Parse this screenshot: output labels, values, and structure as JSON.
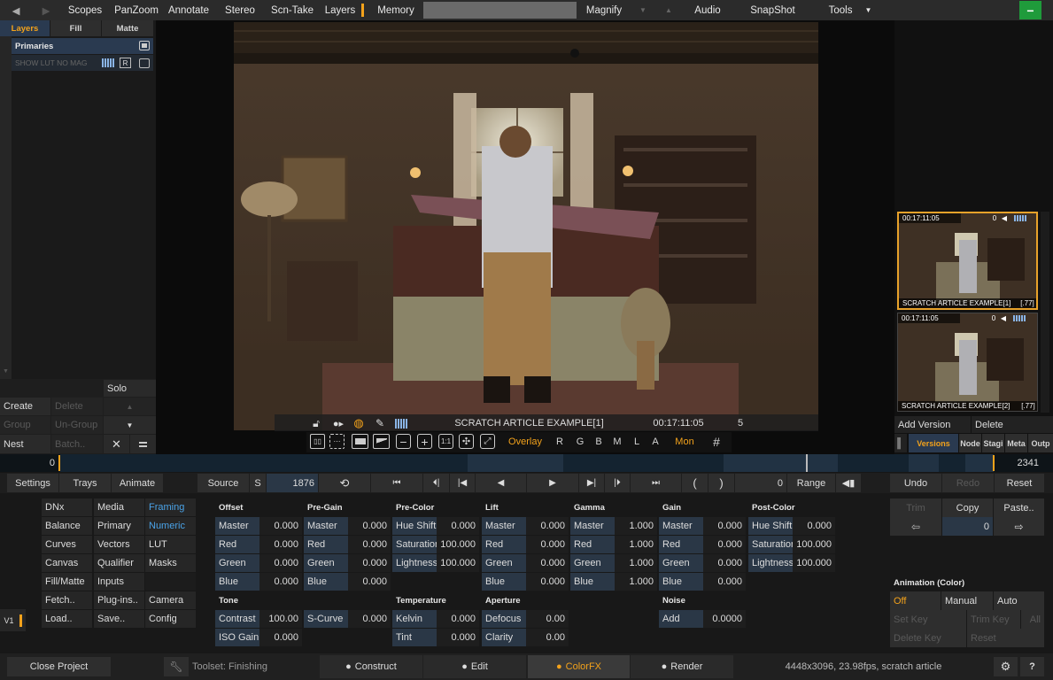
{
  "topbar": {
    "items": [
      "Scopes",
      "PanZoom",
      "Annotate",
      "Stereo",
      "Scn-Take",
      "Layers",
      "Memory",
      "Magnify",
      "Audio",
      "SnapShot",
      "Tools"
    ]
  },
  "left": {
    "tabs": [
      "Layers",
      "Fill",
      "Matte"
    ],
    "primaries": "Primaries",
    "lut_label": "SHOW LUT NO MAG",
    "lut_r": "R",
    "solo": "Solo",
    "actions": [
      "Create",
      "Delete",
      "Group",
      "Un-Group",
      "Nest",
      "Batch.."
    ]
  },
  "viewer": {
    "clip_name": "SCRATCH ARTICLE EXAMPLE[1]",
    "timecode": "00:17:11:05",
    "frame": "5",
    "tools": {
      "overlay": "Overlay",
      "r": "R",
      "g": "G",
      "b": "B",
      "m": "M",
      "l": "L",
      "a": "A",
      "mon": "Mon",
      "one_to_one": "1:1"
    }
  },
  "versions": [
    {
      "timecode": "00:17:11:05",
      "indicator": "0",
      "name": "SCRATCH ARTICLE EXAMPLE[1]",
      "range": "[.77]"
    },
    {
      "timecode": "00:17:11:05",
      "indicator": "0",
      "name": "SCRATCH ARTICLE EXAMPLE[2]",
      "range": "[.77]"
    }
  ],
  "version_actions": {
    "add": "Add Version",
    "delete": "Delete"
  },
  "version_tabs": [
    "Versions",
    "Node",
    "Stagi",
    "Meta",
    "Outp"
  ],
  "timeline": {
    "start": "0",
    "end": "2341"
  },
  "transport": {
    "settings": "Settings",
    "trays": "Trays",
    "animate": "Animate",
    "source": "Source",
    "s": "S",
    "frame": "1876",
    "range_value": "0",
    "range": "Range",
    "undo": "Undo",
    "redo": "Redo",
    "reset": "Reset"
  },
  "menu": [
    [
      "DNx",
      "Media",
      "Framing"
    ],
    [
      "Balance",
      "Primary",
      "Numeric"
    ],
    [
      "Curves",
      "Vectors",
      "LUT"
    ],
    [
      "Canvas",
      "Qualifier",
      "Masks"
    ],
    [
      "Fill/Matte",
      "Inputs",
      ""
    ],
    [
      "Fetch..",
      "Plug-ins..",
      "Camera"
    ],
    [
      "Load..",
      "Save..",
      "Config"
    ]
  ],
  "v1": "V1",
  "groups": {
    "offset": {
      "title": "Offset",
      "rows": [
        [
          "Master",
          "0.000"
        ],
        [
          "Red",
          "0.000"
        ],
        [
          "Green",
          "0.000"
        ],
        [
          "Blue",
          "0.000"
        ]
      ]
    },
    "pregain": {
      "title": "Pre-Gain",
      "rows": [
        [
          "Master",
          "0.000"
        ],
        [
          "Red",
          "0.000"
        ],
        [
          "Green",
          "0.000"
        ],
        [
          "Blue",
          "0.000"
        ]
      ]
    },
    "precolor": {
      "title": "Pre-Color",
      "rows": [
        [
          "Hue Shift",
          "0.000"
        ],
        [
          "Saturation",
          "100.000"
        ],
        [
          "Lightness",
          "100.000"
        ]
      ]
    },
    "lift": {
      "title": "Lift",
      "rows": [
        [
          "Master",
          "0.000"
        ],
        [
          "Red",
          "0.000"
        ],
        [
          "Green",
          "0.000"
        ],
        [
          "Blue",
          "0.000"
        ]
      ]
    },
    "gamma": {
      "title": "Gamma",
      "rows": [
        [
          "Master",
          "1.000"
        ],
        [
          "Red",
          "1.000"
        ],
        [
          "Green",
          "1.000"
        ],
        [
          "Blue",
          "1.000"
        ]
      ]
    },
    "gain": {
      "title": "Gain",
      "rows": [
        [
          "Master",
          "0.000"
        ],
        [
          "Red",
          "0.000"
        ],
        [
          "Green",
          "0.000"
        ],
        [
          "Blue",
          "0.000"
        ]
      ]
    },
    "postcolor": {
      "title": "Post-Color",
      "rows": [
        [
          "Hue Shift",
          "0.000"
        ],
        [
          "Saturation",
          "100.000"
        ],
        [
          "Lightness",
          "100.000"
        ]
      ]
    },
    "tone": {
      "title": "Tone",
      "rows": [
        [
          "Contrast",
          "100.00"
        ],
        [
          "ISO Gain",
          "0.000"
        ]
      ]
    },
    "scurve": {
      "rows": [
        [
          "S-Curve",
          "0.000"
        ]
      ]
    },
    "temperature": {
      "title": "Temperature",
      "rows": [
        [
          "Kelvin",
          "0.000"
        ],
        [
          "Tint",
          "0.000"
        ]
      ]
    },
    "aperture": {
      "title": "Aperture",
      "rows": [
        [
          "Defocus",
          "0.00"
        ],
        [
          "Clarity",
          "0.00"
        ]
      ]
    },
    "noise": {
      "title": "Noise",
      "rows": [
        [
          "Add",
          "0.0000"
        ]
      ]
    }
  },
  "right": {
    "trim": "Trim",
    "copy": "Copy",
    "paste": "Paste..",
    "copy_value": "0",
    "anim_title": "Animation (Color)",
    "anim_modes": [
      "Off",
      "Manual",
      "Auto"
    ],
    "set_key": "Set Key",
    "trim_key": "Trim Key",
    "all": "All",
    "delete_key": "Delete Key",
    "reset": "Reset"
  },
  "bottom": {
    "close": "Close Project",
    "toolset": "Toolset: Finishing",
    "tabs": [
      "Construct",
      "Edit",
      "ColorFX",
      "Render"
    ],
    "info": "4448x3096, 23.98fps, scratch article",
    "help": "?"
  },
  "colors": {
    "accent": "#f3a21b",
    "blue_value": "#2a3746",
    "active_version": "#e8a22a"
  }
}
